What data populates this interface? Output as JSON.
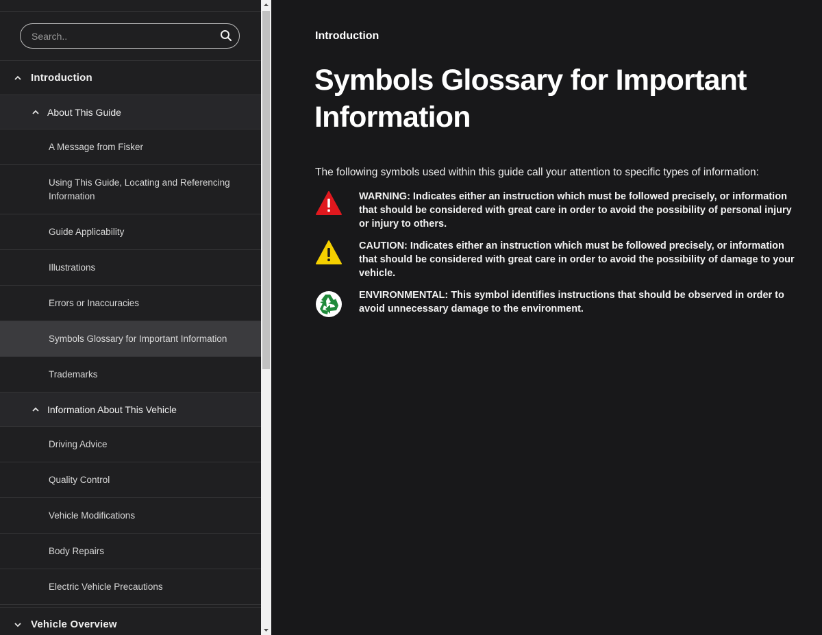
{
  "search": {
    "placeholder": "Search.."
  },
  "nav": {
    "introduction": "Introduction",
    "about_guide": "About This Guide",
    "about_items": [
      "A Message from Fisker",
      "Using This Guide, Locating and Referencing Information",
      "Guide Applicability",
      "Illustrations",
      "Errors or Inaccuracies",
      "Symbols Glossary for Important Information",
      "Trademarks"
    ],
    "info_vehicle": "Information About This Vehicle",
    "vehicle_items": [
      "Driving Advice",
      "Quality Control",
      "Vehicle Modifications",
      "Body Repairs",
      "Electric Vehicle Precautions"
    ],
    "vehicle_overview": "Vehicle Overview"
  },
  "main": {
    "breadcrumb": "Introduction",
    "title": "Symbols Glossary for Important Information",
    "intro": "The following symbols used within this guide call your attention to specific types of information:",
    "symbols": [
      {
        "icon": "warning-icon",
        "color": "#e0181e",
        "text": "WARNING: Indicates either an instruction which must be followed precisely, or information that should be considered with great care in order to avoid the possibility of personal injury or injury to others."
      },
      {
        "icon": "caution-icon",
        "color": "#f5d000",
        "text": "CAUTION: Indicates either an instruction which must be followed precisely, or information that should be considered with great care in order to avoid the possibility of damage to your vehicle."
      },
      {
        "icon": "recycle-icon",
        "color": "#1f8a3a",
        "text": "ENVIRONMENTAL: This symbol identifies instructions that should be observed in order to avoid unnecessary damage to the environment."
      }
    ]
  }
}
